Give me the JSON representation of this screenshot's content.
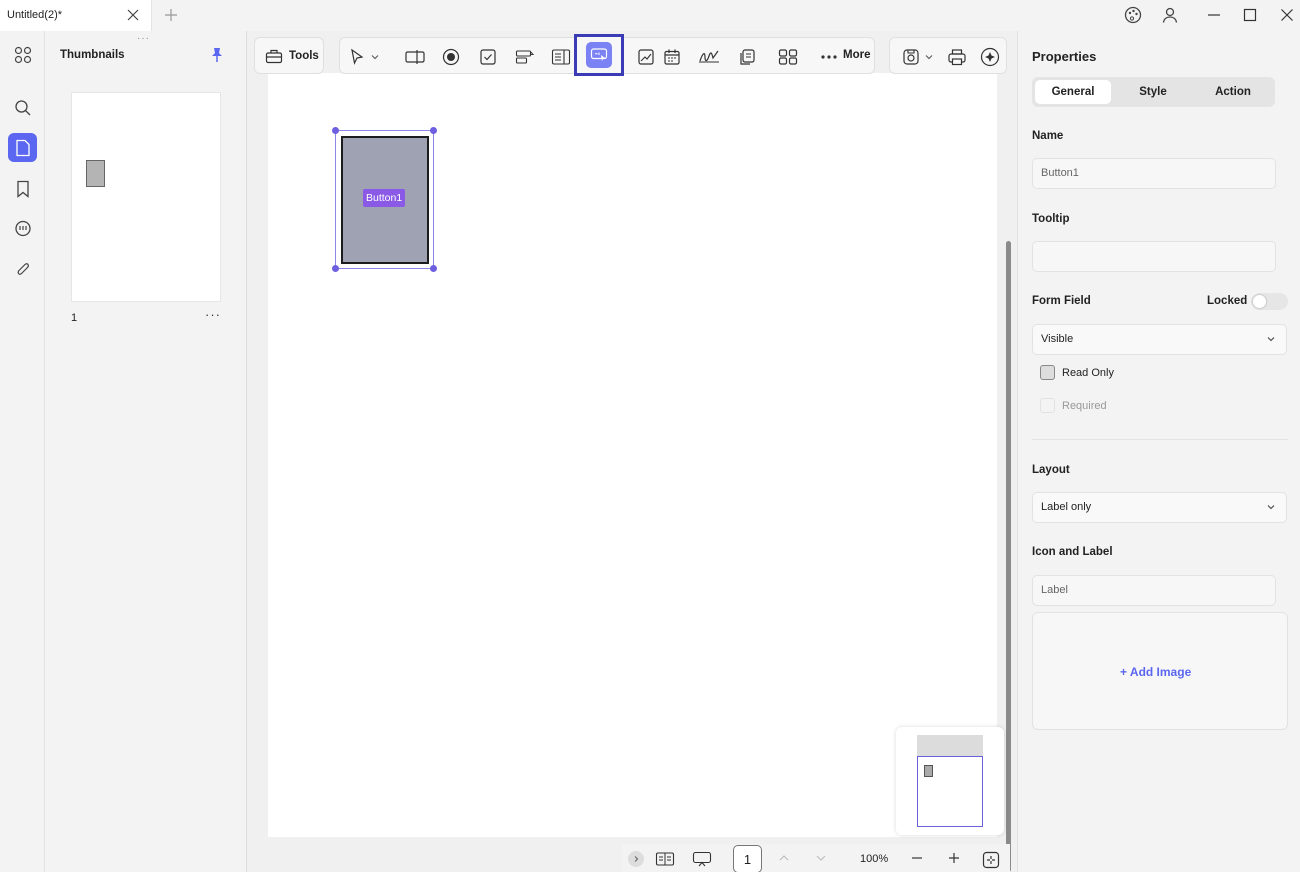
{
  "titlebar": {
    "tab_title": "Untitled(2)*",
    "icons": [
      "theme-icon",
      "account-icon",
      "minimize-icon",
      "maximize-icon",
      "close-icon"
    ]
  },
  "leftrail": {
    "items": [
      "grid-icon",
      "search-icon",
      "thumbnails-icon",
      "bookmark-icon",
      "comment-icon",
      "attachment-icon"
    ],
    "active": "thumbnails-icon"
  },
  "thumbnails": {
    "title": "Thumbnails",
    "pages": [
      {
        "number": "1",
        "more": "···"
      }
    ]
  },
  "toolbar": {
    "tools_label": "Tools",
    "more_label": "More",
    "active_tool": "button-field"
  },
  "canvas": {
    "form_button_label": "Button1"
  },
  "bottombar": {
    "page_number": "1",
    "zoom": "100%"
  },
  "properties": {
    "title": "Properties",
    "tabs": [
      "General",
      "Style",
      "Action"
    ],
    "active_tab": "General",
    "name_label": "Name",
    "name_value": "Button1",
    "tooltip_label": "Tooltip",
    "tooltip_value": "",
    "form_field_label": "Form Field",
    "locked_label": "Locked",
    "visibility_value": "Visible",
    "read_only_label": "Read Only",
    "required_label": "Required",
    "layout_label": "Layout",
    "layout_value": "Label only",
    "icon_label_title": "Icon and Label",
    "label_placeholder": "Label",
    "add_image_label": "+ Add Image"
  },
  "colors": {
    "accent": "#5b67f0",
    "selection": "#6d5fe0",
    "highlight_border": "#3b3bb5",
    "button_label_bg": "#8a5ae6"
  }
}
